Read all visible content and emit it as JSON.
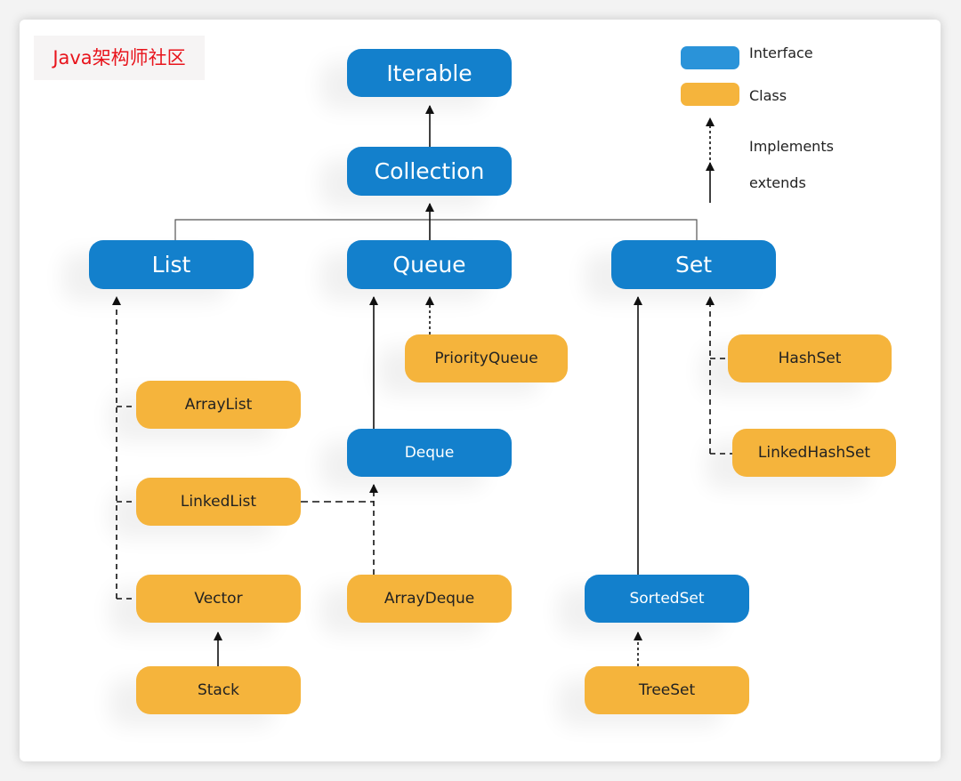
{
  "brand": "Java架构师社区",
  "colors": {
    "interface": "#1380cc",
    "class": "#f5b43c"
  },
  "legend": {
    "interface": "Interface",
    "class": "Class",
    "implements": "Implements",
    "extends": "extends"
  },
  "nodes": {
    "iterable": {
      "label": "Iterable",
      "kind": "interface"
    },
    "collection": {
      "label": "Collection",
      "kind": "interface"
    },
    "list": {
      "label": "List",
      "kind": "interface"
    },
    "queue": {
      "label": "Queue",
      "kind": "interface"
    },
    "set": {
      "label": "Set",
      "kind": "interface"
    },
    "priorityqueue": {
      "label": "PriorityQueue",
      "kind": "class"
    },
    "arraylist": {
      "label": "ArrayList",
      "kind": "class"
    },
    "deque": {
      "label": "Deque",
      "kind": "interface"
    },
    "hashset": {
      "label": "HashSet",
      "kind": "class"
    },
    "linkedhashset": {
      "label": "LinkedHashSet",
      "kind": "class"
    },
    "linkedlist": {
      "label": "LinkedList",
      "kind": "class"
    },
    "vector": {
      "label": "Vector",
      "kind": "class"
    },
    "arraydeque": {
      "label": "ArrayDeque",
      "kind": "class"
    },
    "sortedset": {
      "label": "SortedSet",
      "kind": "interface"
    },
    "stack": {
      "label": "Stack",
      "kind": "class"
    },
    "treeset": {
      "label": "TreeSet",
      "kind": "class"
    }
  }
}
